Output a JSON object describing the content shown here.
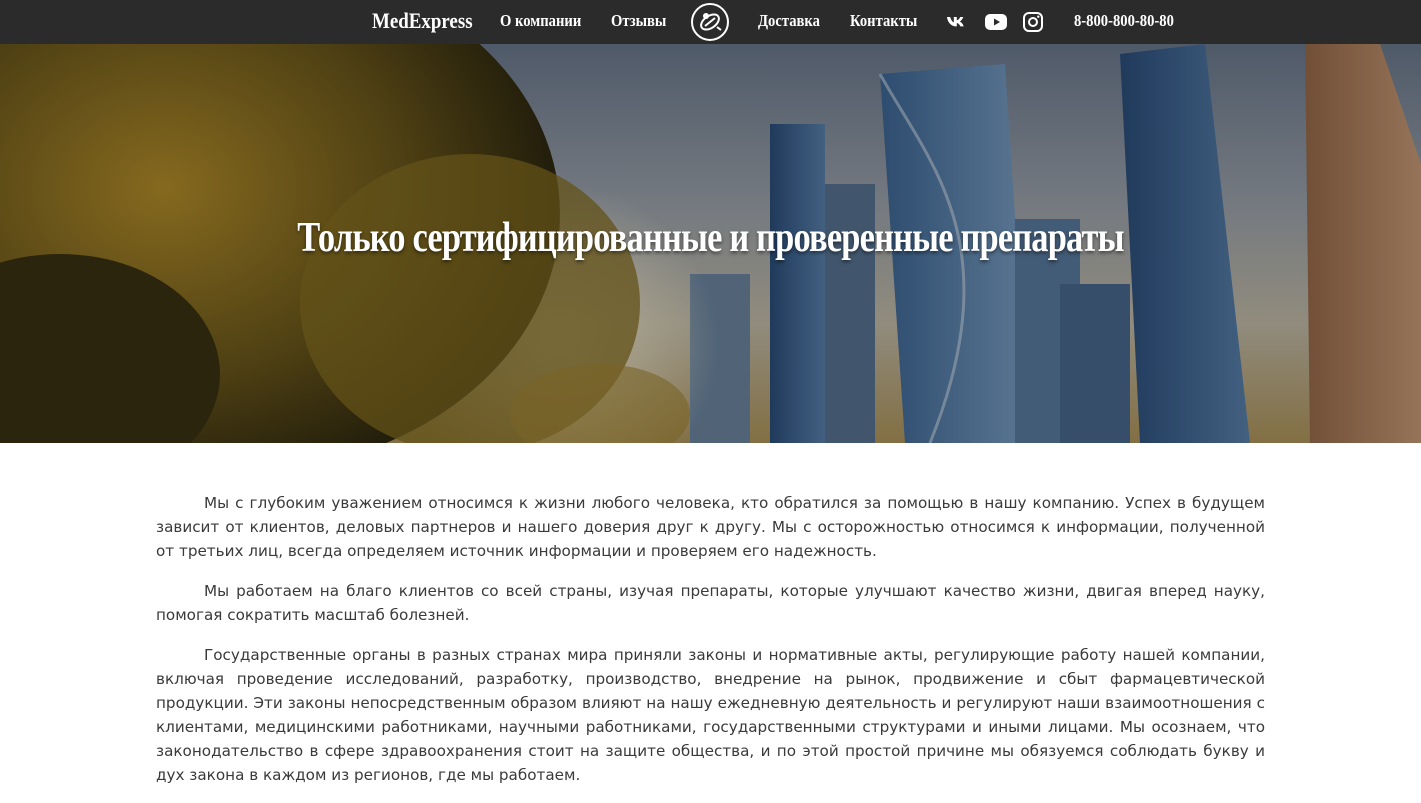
{
  "nav": {
    "brand": "MedExpress",
    "items": [
      "О компании",
      "Отзывы",
      "Доставка",
      "Контакты"
    ],
    "phone": "8-800-800-80-80",
    "social": [
      "vk-icon",
      "youtube-icon",
      "instagram-icon"
    ],
    "logo_icon": "pills-icon"
  },
  "hero": {
    "title": "Только сертифицированные и проверенные препараты"
  },
  "content": {
    "paragraphs": [
      "Мы с глубоким уважением относимся к жизни любого человека, кто обратился за помощью в нашу компанию. Успех в будущем зависит от клиентов, деловых партнеров и нашего доверия друг к другу. Мы с осторожностью относимся к информации, полученной от третьих лиц, всегда определяем источник информации и проверяем его надежность.",
      "Мы работаем на благо клиентов со всей страны, изучая препараты, которые улучшают качество жизни, двигая вперед науку, помогая сократить масштаб болезней.",
      "Государственные органы в разных странах мира приняли законы и нормативные акты, регулирующие работу нашей компании, включая проведение исследований, разработку, производство, внедрение на рынок, продвижение и сбыт фармацевтической продукции. Эти законы непосредственным образом влияют на нашу ежедневную деятельность и регулируют наши взаимоотношения с клиентами, медицинскими работниками, научными работниками, государственными структурами и иными лицами. Мы осознаем, что законодательство в сфере здравоохранения стоит на защите общества, и по этой простой причине мы обязуемся соблюдать букву и дух закона в каждом из регионов, где мы работаем."
    ]
  },
  "colors": {
    "topbar": "#2b2b2b",
    "text": "#3a3a3a",
    "white": "#ffffff"
  }
}
